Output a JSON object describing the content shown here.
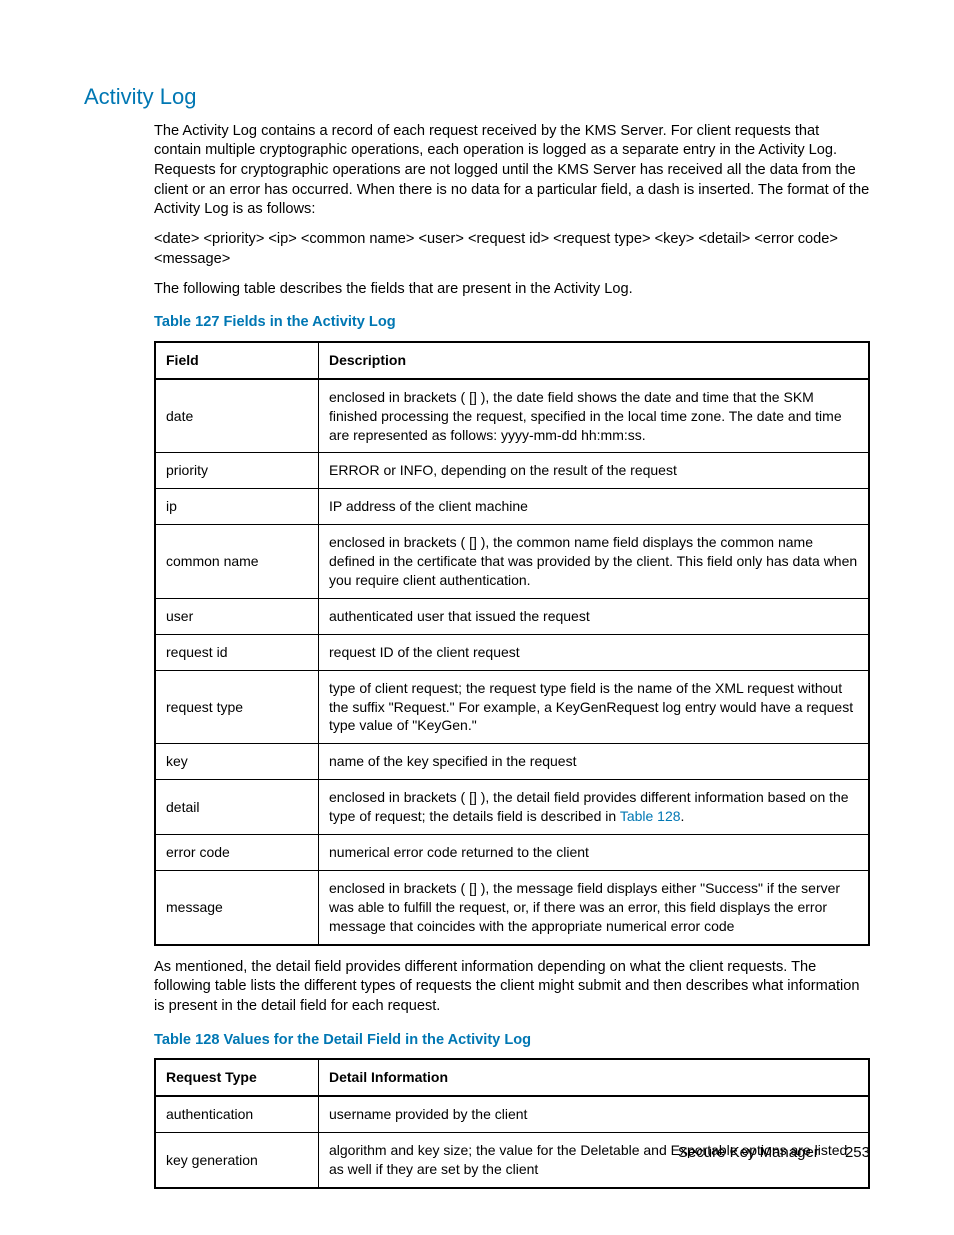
{
  "heading": "Activity Log",
  "intro_p1": "The Activity Log contains a record of each request received by the KMS Server. For client requests that contain multiple cryptographic operations, each operation is logged as a separate entry in the Activity Log. Requests for cryptographic operations are not logged until the KMS Server has received all the data from the client or an error has occurred. When there is no data for a particular field, a dash is inserted. The format of the Activity Log is as follows:",
  "format_line": "<date> <priority> <ip> <common name> <user> <request id> <request type> <key> <detail> <error code> <message>",
  "intro_p2": "The following table describes the fields that are present in the Activity Log.",
  "table127": {
    "title": "Table 127 Fields in the Activity Log",
    "col1_header": "Field",
    "col2_header": "Description",
    "rows": {
      "r0": {
        "field": "date",
        "desc": "enclosed in brackets ( [] ), the date field shows the date and time that the SKM finished processing the request, specified in the local time zone. The date and time are represented as follows: yyyy-mm-dd hh:mm:ss."
      },
      "r1": {
        "field": "priority",
        "desc": "ERROR or INFO, depending on the result of the request"
      },
      "r2": {
        "field": "ip",
        "desc": "IP address of the client machine"
      },
      "r3": {
        "field": "common name",
        "desc": "enclosed in brackets ( [] ), the common name field displays the common name defined in the certificate that was provided by the client. This field only has data when you require client authentication."
      },
      "r4": {
        "field": "user",
        "desc": "authenticated user that issued the request"
      },
      "r5": {
        "field": "request id",
        "desc": "request ID of the client request"
      },
      "r6": {
        "field": "request type",
        "desc": "type of client request; the request type field is the name of the XML request without the suffix \"Request.\" For example, a KeyGenRequest log entry would have a request type value of \"KeyGen.\""
      },
      "r7": {
        "field": "key",
        "desc": "name of the key specified in the request"
      },
      "r8": {
        "field": "detail",
        "desc_pre": "enclosed in brackets ( [] ), the detail field provides different information based on the type of request; the details field is described in ",
        "link": "Table 128",
        "desc_post": "."
      },
      "r9": {
        "field": "error code",
        "desc": "numerical error code returned to the client"
      },
      "r10": {
        "field": "message",
        "desc": "enclosed in brackets ( [] ), the message field displays either \"Success\" if the server was able to fulfill the request, or, if there was an error, this field displays the error message that coincides with the appropriate numerical error code"
      }
    }
  },
  "mid_p": "As mentioned, the detail field provides different information depending on what the client requests. The following table lists the different types of requests the client might submit and then describes what information is present in the detail field for each request.",
  "table128": {
    "title": "Table 128 Values for the Detail Field in the Activity Log",
    "col1_header": "Request Type",
    "col2_header": "Detail Information",
    "rows": {
      "r0": {
        "type": "authentication",
        "info": "username provided by the client"
      },
      "r1": {
        "type": "key generation",
        "info": "algorithm and key size; the value for the Deletable and Exportable options are listed as well if they are set by the client"
      }
    }
  },
  "footer": {
    "doc_title": "Secure Key Manager",
    "page_num": "253"
  }
}
